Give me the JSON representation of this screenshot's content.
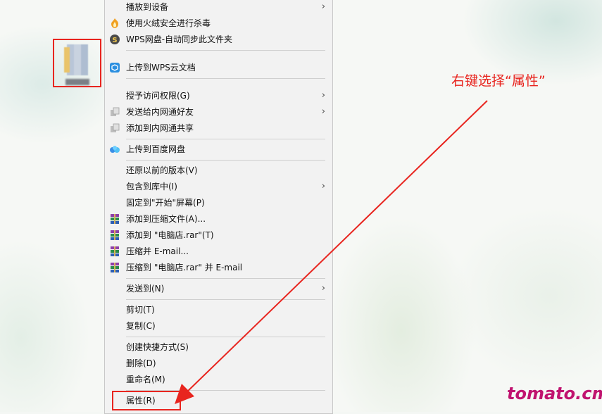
{
  "menu": {
    "items": [
      {
        "label": "播放到设备",
        "icon": "",
        "submenu": true
      },
      {
        "label": "使用火绒安全进行杀毒",
        "icon": "huorong-shield-icon",
        "submenu": false
      },
      {
        "label": "WPS网盘-自动同步此文件夹",
        "icon": "wps-cloud-s-icon",
        "submenu": false
      },
      {
        "label": "上传到WPS云文档",
        "icon": "wps-cube-icon",
        "submenu": false
      },
      {
        "label": "授予访问权限(G)",
        "icon": "",
        "submenu": true
      },
      {
        "label": "发送给内网通好友",
        "icon": "neiwangtong-icon",
        "submenu": true
      },
      {
        "label": "添加到内网通共享",
        "icon": "neiwangtong-icon",
        "submenu": false
      },
      {
        "label": "上传到百度网盘",
        "icon": "baidu-netdisk-icon",
        "submenu": false
      },
      {
        "label": "还原以前的版本(V)",
        "icon": "",
        "submenu": false
      },
      {
        "label": "包含到库中(I)",
        "icon": "",
        "submenu": true
      },
      {
        "label": "固定到\"开始\"屏幕(P)",
        "icon": "",
        "submenu": false
      },
      {
        "label": "添加到压缩文件(A)...",
        "icon": "winrar-icon",
        "submenu": false
      },
      {
        "label": "添加到 \"电脑店.rar\"(T)",
        "icon": "winrar-icon",
        "submenu": false
      },
      {
        "label": "压缩并 E-mail...",
        "icon": "winrar-icon",
        "submenu": false
      },
      {
        "label": "压缩到 \"电脑店.rar\" 并 E-mail",
        "icon": "winrar-icon",
        "submenu": false
      },
      {
        "label": "发送到(N)",
        "icon": "",
        "submenu": true
      },
      {
        "label": "剪切(T)",
        "icon": "",
        "submenu": false
      },
      {
        "label": "复制(C)",
        "icon": "",
        "submenu": false
      },
      {
        "label": "创建快捷方式(S)",
        "icon": "",
        "submenu": false
      },
      {
        "label": "删除(D)",
        "icon": "",
        "submenu": false
      },
      {
        "label": "重命名(M)",
        "icon": "",
        "submenu": false
      },
      {
        "label": "属性(R)",
        "icon": "",
        "submenu": false
      }
    ]
  },
  "annotation": {
    "text": "右键选择“属性”",
    "color": "#e8251f"
  },
  "watermark": {
    "text": "tomato.cm",
    "color": "#c0136f"
  }
}
